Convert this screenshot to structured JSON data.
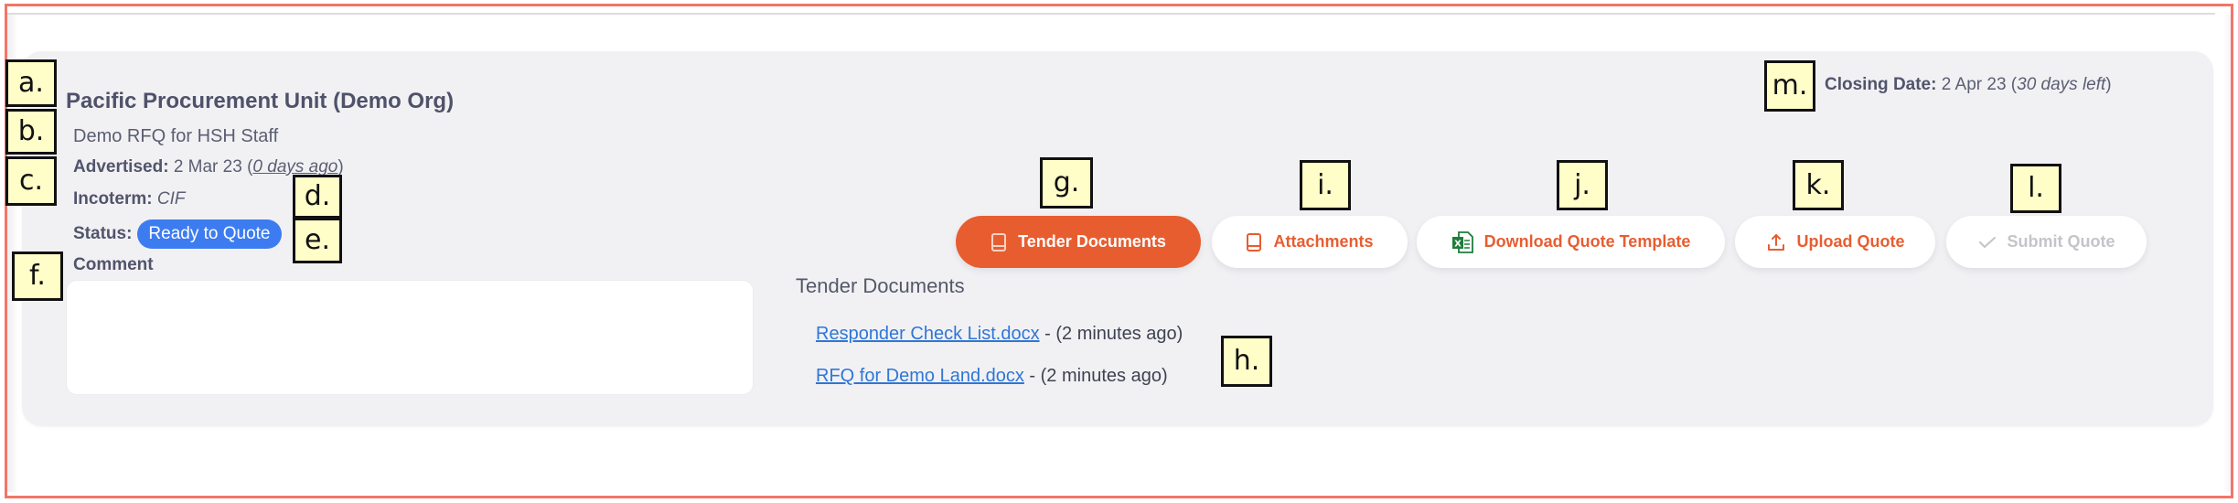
{
  "header": {
    "organization": "Pacific Procurement Unit (Demo Org)",
    "rfq_title": "Demo RFQ for HSH Staff",
    "advertised": {
      "label": "Advertised:",
      "date": "2 Mar 23",
      "relative": "0 days ago"
    },
    "incoterm": {
      "label": "Incoterm:",
      "value": "CIF"
    },
    "status": {
      "label": "Status:",
      "value": "Ready to Quote",
      "color": "#3d7cf0"
    },
    "comment": {
      "label": "Comment",
      "value": "",
      "placeholder": ""
    },
    "closing": {
      "label": "Closing Date:",
      "date": "2 Apr 23",
      "relative": "30 days left"
    }
  },
  "actions": {
    "tender_documents": {
      "label": "Tender Documents",
      "icon": "book-icon"
    },
    "attachments": {
      "label": "Attachments",
      "icon": "book-icon"
    },
    "download_template": {
      "label": "Download Quote Template",
      "icon": "excel-file-icon"
    },
    "upload_quote": {
      "label": "Upload Quote",
      "icon": "upload-icon"
    },
    "submit_quote": {
      "label": "Submit Quote",
      "icon": "check-icon",
      "disabled": true
    }
  },
  "tender_documents": {
    "heading": "Tender Documents",
    "items": [
      {
        "name": "Responder Check List.docx",
        "age": " - (2 minutes ago)"
      },
      {
        "name": "RFQ for Demo Land.docx",
        "age": " - (2 minutes ago)"
      }
    ]
  },
  "markers": [
    "a.",
    "b.",
    "c.",
    "d.",
    "e.",
    "f.",
    "g.",
    "h.",
    "i.",
    "j.",
    "k.",
    "l.",
    "m."
  ],
  "colors": {
    "accent": "#e85d30",
    "status_badge": "#3d7cf0",
    "link": "#2f76d6",
    "excel_green": "#1e7d3c",
    "frame_border": "#f0766a"
  }
}
